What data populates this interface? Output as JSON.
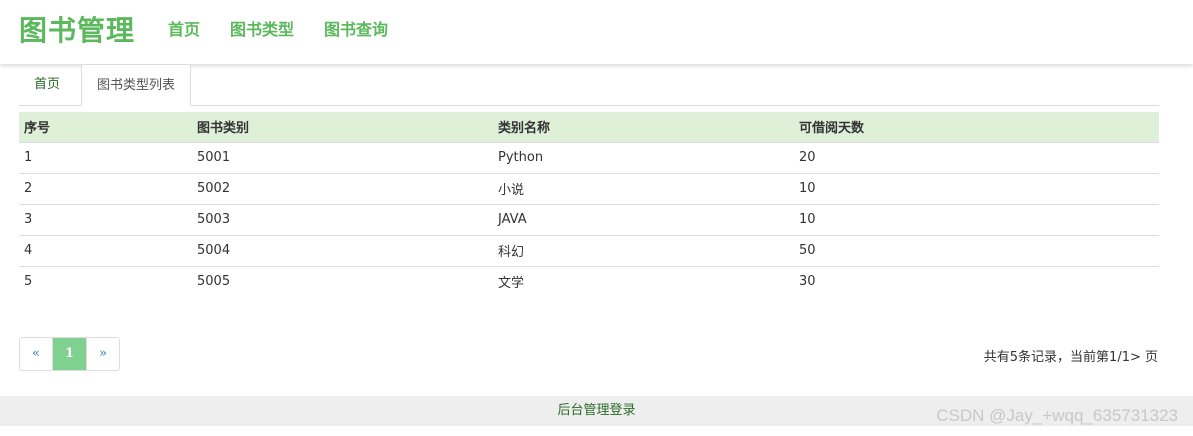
{
  "header": {
    "brand": "图书管理",
    "nav": [
      "首页",
      "图书类型",
      "图书查询"
    ]
  },
  "tabs": [
    {
      "label": "首页"
    },
    {
      "label": "图书类型列表"
    }
  ],
  "table": {
    "columns": [
      "序号",
      "图书类别",
      "类别名称",
      "可借阅天数"
    ],
    "rows": [
      [
        "1",
        "5001",
        "Python",
        "20"
      ],
      [
        "2",
        "5002",
        "小说",
        "10"
      ],
      [
        "3",
        "5003",
        "JAVA",
        "10"
      ],
      [
        "4",
        "5004",
        "科幻",
        "50"
      ],
      [
        "5",
        "5005",
        "文学",
        "30"
      ]
    ]
  },
  "pagination": {
    "prev": "«",
    "current": "1",
    "next": "»",
    "info": "共有5条记录，当前第1/1> 页"
  },
  "footer": {
    "link": "后台管理登录"
  },
  "watermark": "CSDN @Jay_+wqq_635731323",
  "colors": {
    "brand": "#5cb85c",
    "header_row": "#dff0d8",
    "active_page": "#7fd18f"
  }
}
